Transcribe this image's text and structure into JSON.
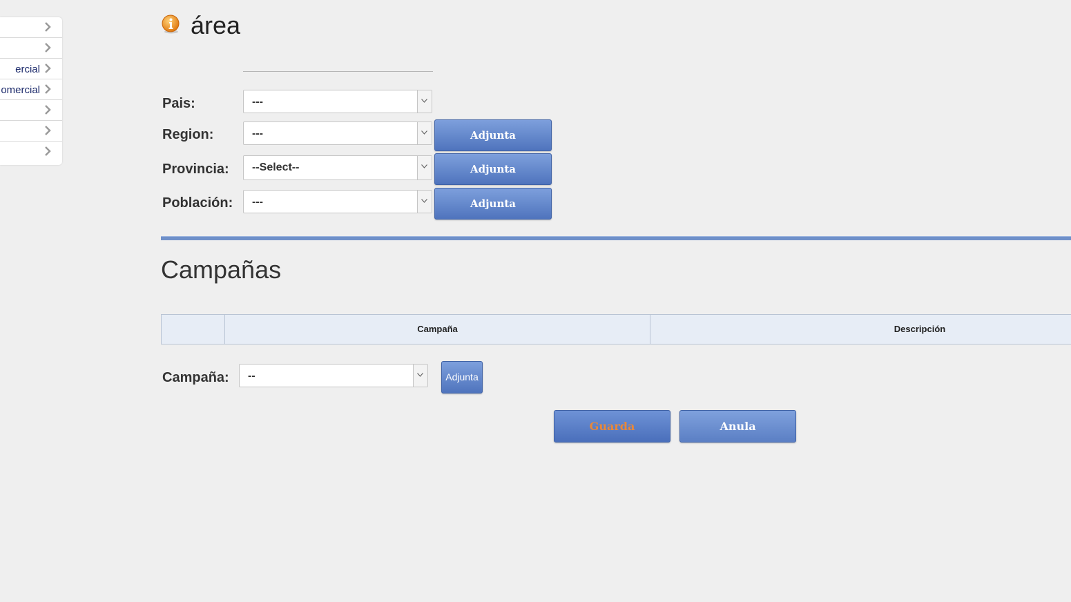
{
  "sidebar": {
    "items": [
      {
        "label": ""
      },
      {
        "label": ""
      },
      {
        "label": "ercial"
      },
      {
        "label": "omercial"
      },
      {
        "label": ""
      },
      {
        "label": ""
      },
      {
        "label": ""
      }
    ]
  },
  "header": {
    "title": "área",
    "icon": "info-icon"
  },
  "form": {
    "pais": {
      "label": "Pais:",
      "value": "---"
    },
    "region": {
      "label": "Region:",
      "value": "---",
      "button": "Adjunta"
    },
    "provincia": {
      "label": "Provincia:",
      "value": "--Select--",
      "button": "Adjunta"
    },
    "poblacion": {
      "label": "Población:",
      "value": "---",
      "button": "Adjunta"
    }
  },
  "campanas": {
    "title": "Campañas",
    "table": {
      "headers": [
        "",
        "Campaña",
        "Descripción"
      ]
    },
    "campana": {
      "label": "Campaña:",
      "value": "--",
      "button": "Adjunta"
    }
  },
  "actions": {
    "save": "Guarda",
    "cancel": "Anula"
  },
  "colors": {
    "accent": "#5577c0",
    "save_text": "#e8883a",
    "separator": "#6f90c9"
  }
}
